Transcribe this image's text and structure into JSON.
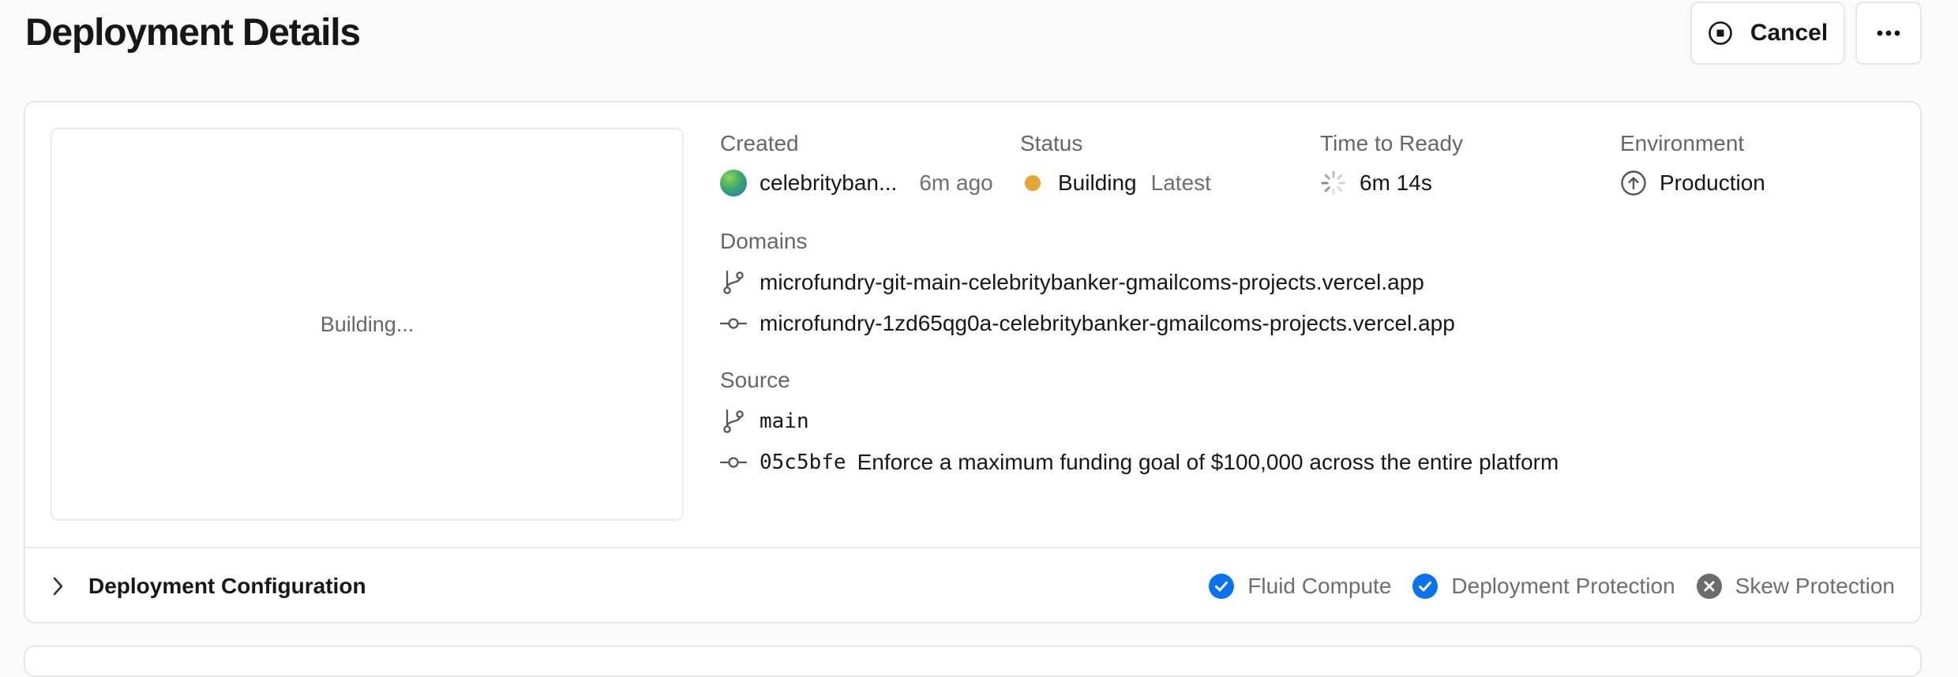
{
  "page": {
    "title": "Deployment Details"
  },
  "actions": {
    "cancel_label": "Cancel",
    "more_label": "More actions"
  },
  "preview": {
    "status_text": "Building..."
  },
  "meta": {
    "created": {
      "label": "Created",
      "user": "celebrityban...",
      "time": "6m ago"
    },
    "status": {
      "label": "Status",
      "value": "Building",
      "tag": "Latest",
      "color": "#e5a536"
    },
    "time_to_ready": {
      "label": "Time to Ready",
      "value": "6m 14s"
    },
    "environment": {
      "label": "Environment",
      "value": "Production"
    }
  },
  "domains": {
    "label": "Domains",
    "items": [
      {
        "icon": "git-branch-icon",
        "url": "microfundry-git-main-celebritybanker-gmailcoms-projects.vercel.app"
      },
      {
        "icon": "git-commit-icon",
        "url": "microfundry-1zd65qg0a-celebritybanker-gmailcoms-projects.vercel.app"
      }
    ]
  },
  "source": {
    "label": "Source",
    "branch": "main",
    "commit_hash": "05c5bfe",
    "commit_message": "Enforce a maximum funding goal of $100,000 across the entire platform"
  },
  "config": {
    "label": "Deployment Configuration",
    "features": [
      {
        "label": "Fluid Compute",
        "enabled": true
      },
      {
        "label": "Deployment Protection",
        "enabled": true
      },
      {
        "label": "Skew Protection",
        "enabled": false
      }
    ]
  },
  "colors": {
    "enabled": "#0a72ef",
    "disabled": "#6b6b6b",
    "border": "#e6e6e6",
    "muted": "#666666"
  }
}
